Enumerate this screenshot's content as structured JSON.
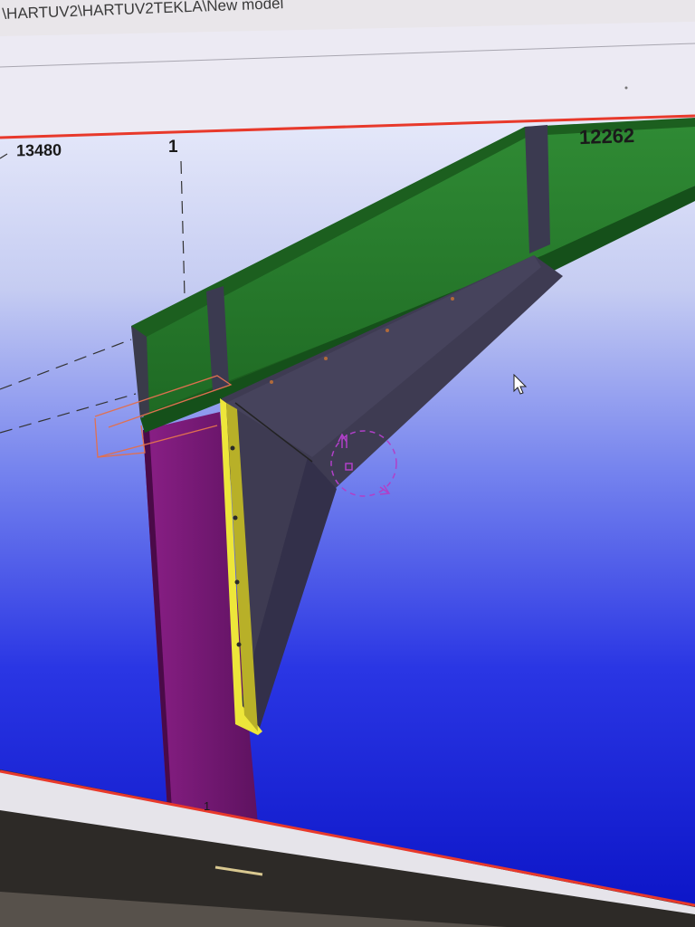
{
  "window": {
    "path": "\\HARTUV2\\HARTUV2TEKLA\\New model"
  },
  "model_view": {
    "dimension_left": "13480",
    "grid_label": "1",
    "dimension_right": "12262",
    "bottom_grid_label": "1"
  },
  "colors": {
    "background_top": "#dde3f7",
    "background_bottom": "#1420e0",
    "beam": "#2e7d32",
    "haunch": "#3d3a4f",
    "column": "#7a1a78",
    "end_plate": "#e8e030",
    "border": "#e8392b",
    "selection": "#e07050",
    "handle": "#b040c8"
  }
}
